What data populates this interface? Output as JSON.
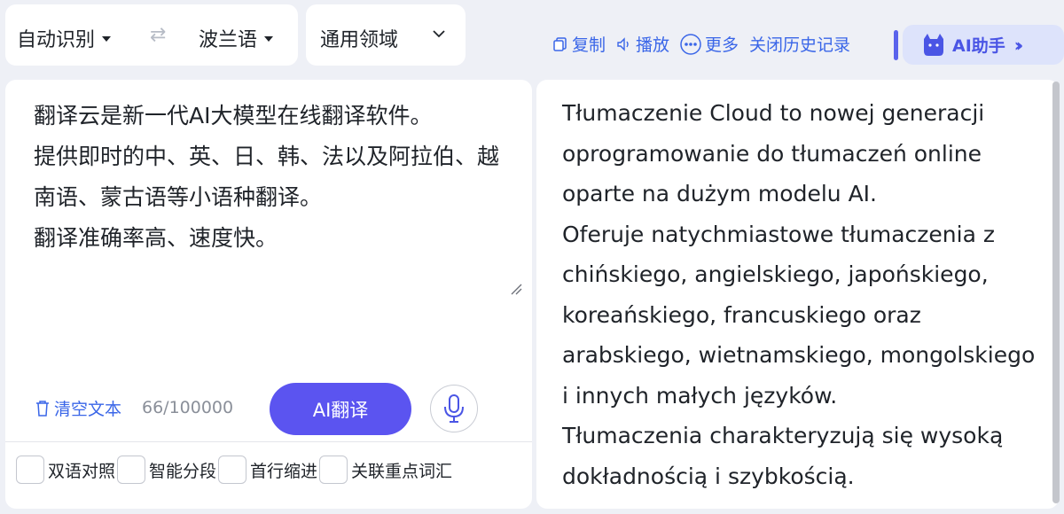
{
  "lang": {
    "source": "自动识别",
    "swap_icon": "swap-arrows-icon",
    "target": "波兰语"
  },
  "domain": {
    "selected": "通用领域"
  },
  "toolbar": {
    "copy": "复制",
    "play": "播放",
    "more": "更多",
    "close_history": "关闭历史记录",
    "ai_assistant": "AI助手",
    "accent": "#3a66e8"
  },
  "source": {
    "text": "翻译云是新一代AI大模型在线翻译软件。\n提供即时的中、英、日、韩、法以及阿拉伯、越南语、蒙古语等小语种翻译。\n翻译准确率高、速度快。",
    "clear_label": "清空文本",
    "counter": "66/100000",
    "translate_button": "AI翻译",
    "button_color": "#5b54f0"
  },
  "options": [
    {
      "label": "双语对照"
    },
    {
      "label": "智能分段"
    },
    {
      "label": "首行缩进"
    },
    {
      "label": "关联重点词汇"
    }
  ],
  "target": {
    "text": "Tłumaczenie Cloud to nowej generacji oprogramowanie do tłumaczeń online oparte na dużym modelu AI.\nOferuje natychmiastowe tłumaczenia z chińskiego, angielskiego, japońskiego, koreańskiego, francuskiego oraz arabskiego, wietnamskiego, mongolskiego i innych małych języków.\nTłumaczenia charakteryzują się wysoką dokładnością i szybkością."
  }
}
